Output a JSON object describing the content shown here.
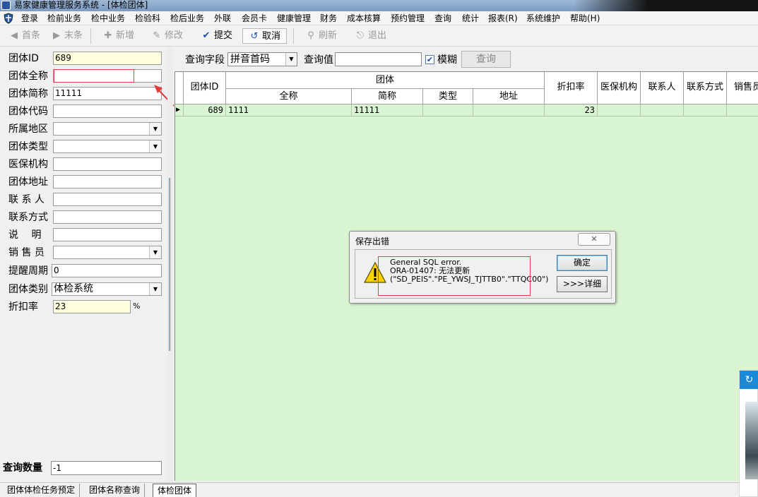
{
  "window": {
    "title": "易家健康管理服务系统 - [体检团体]"
  },
  "menu": [
    "登录",
    "检前业务",
    "检中业务",
    "检验科",
    "检后业务",
    "外联",
    "会员卡",
    "健康管理",
    "财务",
    "成本核算",
    "预约管理",
    "查询",
    "统计",
    "报表(R)",
    "系统维护",
    "帮助(H)"
  ],
  "toolbar": {
    "first": "首条",
    "last": "末条",
    "add": "新增",
    "edit": "修改",
    "submit": "提交",
    "cancel": "取消",
    "refresh": "刷新",
    "exit": "退出"
  },
  "form": {
    "group_id": {
      "label": "团体ID",
      "value": "689"
    },
    "full_name": {
      "label": "团体全称",
      "value": ""
    },
    "short_name": {
      "label": "团体简称",
      "value": "11111"
    },
    "code": {
      "label": "团体代码",
      "value": ""
    },
    "region": {
      "label": "所属地区",
      "value": ""
    },
    "group_type": {
      "label": "团体类型",
      "value": ""
    },
    "insurance": {
      "label": "医保机构",
      "value": ""
    },
    "address": {
      "label": "团体地址",
      "value": ""
    },
    "contact": {
      "label": "联 系 人",
      "value": ""
    },
    "contact_method": {
      "label": "联系方式",
      "value": ""
    },
    "description": {
      "label": "说　 明",
      "value": ""
    },
    "salesperson": {
      "label": "销 售 员",
      "value": ""
    },
    "reminder": {
      "label": "提醒周期",
      "value": "0"
    },
    "category": {
      "label": "团体类别",
      "value": "体检系统"
    },
    "discount": {
      "label": "折扣率",
      "value": "23",
      "unit": "%"
    }
  },
  "query_count": {
    "label": "查询数量",
    "value": "-1"
  },
  "query": {
    "field_label": "查询字段",
    "field_value": "拼音首码",
    "value_label": "查询值",
    "value": "",
    "fuzzy_label": "模糊",
    "fuzzy_checked": true,
    "button": "查询"
  },
  "grid": {
    "group_header": "团体",
    "headers": {
      "id": "团体ID",
      "full": "全称",
      "short": "简称",
      "type": "类型",
      "addr": "地址",
      "discount": "折扣率",
      "insurance": "医保机构",
      "contact": "联系人",
      "contact_method": "联系方式",
      "sales": "销售员"
    },
    "rows": [
      {
        "id": "689",
        "full": "1111",
        "short": "11111",
        "type": "",
        "addr": "",
        "discount": "23",
        "insurance": "",
        "contact": "",
        "contact_method": "",
        "sales": ""
      }
    ]
  },
  "dialog": {
    "title": "保存出错",
    "line1": "General SQL error.",
    "line2": "ORA-01407: 无法更新",
    "line3": "(\"SD_PEIS\".\"PE_YWSJ_TJTTB0\".\"TTQC00\")",
    "ok": "确定",
    "details": ">>>详细"
  },
  "tabs": [
    "团体体检任务预定",
    "团体名称查询",
    "体检团体"
  ],
  "colors": {
    "grid_bg": "#d8f4d0",
    "highlight": "#e04040",
    "accent": "#1a8ad8"
  }
}
